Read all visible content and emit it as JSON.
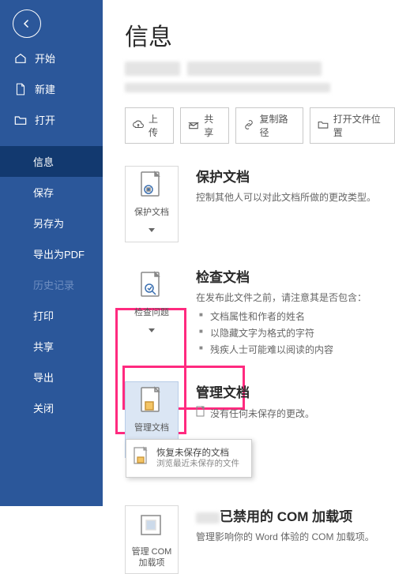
{
  "sidebar": {
    "items": [
      {
        "label": "开始"
      },
      {
        "label": "新建"
      },
      {
        "label": "打开"
      },
      {
        "label": "信息"
      },
      {
        "label": "保存"
      },
      {
        "label": "另存为"
      },
      {
        "label": "导出为PDF"
      },
      {
        "label": "历史记录"
      },
      {
        "label": "打印"
      },
      {
        "label": "共享"
      },
      {
        "label": "导出"
      },
      {
        "label": "关闭"
      }
    ]
  },
  "page": {
    "title": "信息"
  },
  "actions": {
    "upload": "上传",
    "share": "共享",
    "copyPath": "复制路径",
    "openLocation": "打开文件位置"
  },
  "protect": {
    "tile": "保护文档",
    "heading": "保护文档",
    "desc": "控制其他人可以对此文档所做的更改类型。"
  },
  "inspect": {
    "tile": "检查问题",
    "heading": "检查文档",
    "lead": "在发布此文件之前，请注意其是否包含：",
    "items": [
      "文档属性和作者的姓名",
      "以隐藏文字为格式的字符",
      "残疾人士可能难以阅读的内容"
    ]
  },
  "manage": {
    "tile": "管理文档",
    "heading": "管理文档",
    "desc": "没有任何未保存的更改。",
    "dropdown": {
      "title": "恢复未保存的文档",
      "sub": "浏览最近未保存的文件"
    }
  },
  "com": {
    "tile": "管理 COM 加载项",
    "headingSuffix": "已禁用的 COM 加载项",
    "desc": "管理影响你的 Word 体验的 COM 加载项。"
  }
}
